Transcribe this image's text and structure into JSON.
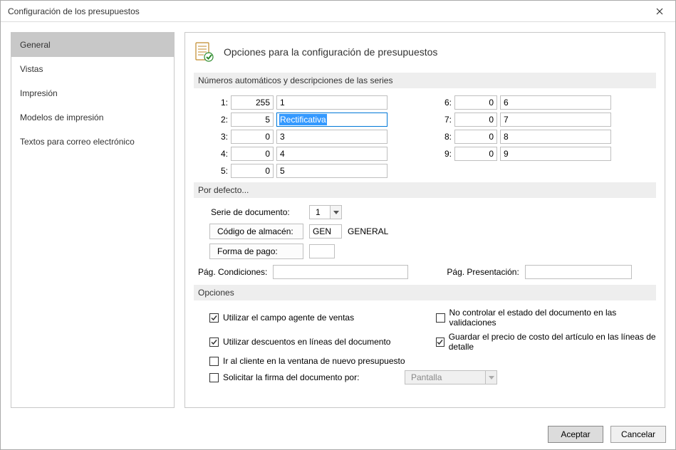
{
  "window": {
    "title": "Configuración de los presupuestos"
  },
  "sidebar": {
    "items": [
      {
        "label": "General",
        "selected": true
      },
      {
        "label": "Vistas"
      },
      {
        "label": "Impresión"
      },
      {
        "label": "Modelos de impresión"
      },
      {
        "label": "Textos para correo electrónico"
      }
    ]
  },
  "header": {
    "title": "Opciones para la configuración de presupuestos"
  },
  "sections": {
    "series": {
      "heading": "Números automáticos y descripciones de las series",
      "rows": [
        {
          "idx": "1:",
          "num": "255",
          "desc": "1"
        },
        {
          "idx": "2:",
          "num": "5",
          "desc": "Rectificativa",
          "focused": true
        },
        {
          "idx": "3:",
          "num": "0",
          "desc": "3"
        },
        {
          "idx": "4:",
          "num": "0",
          "desc": "4"
        },
        {
          "idx": "5:",
          "num": "0",
          "desc": "5"
        },
        {
          "idx": "6:",
          "num": "0",
          "desc": "6"
        },
        {
          "idx": "7:",
          "num": "0",
          "desc": "7"
        },
        {
          "idx": "8:",
          "num": "0",
          "desc": "8"
        },
        {
          "idx": "9:",
          "num": "0",
          "desc": "9"
        }
      ]
    },
    "defaults": {
      "heading": "Por defecto...",
      "serie_label": "Serie de documento:",
      "serie_value": "1",
      "almacen_btn": "Código de almacén:",
      "almacen_code": "GEN",
      "almacen_name": "GENERAL",
      "pago_btn": "Forma de pago:",
      "pago_value": "",
      "cond_label": "Pág. Condiciones:",
      "cond_value": "",
      "pres_label": "Pág. Presentación:",
      "pres_value": ""
    },
    "options": {
      "heading": "Opciones",
      "opt_agent": "Utilizar el campo agente de ventas",
      "opt_no_control": "No controlar el estado del documento en las validaciones",
      "opt_discounts": "Utilizar descuentos en líneas del documento",
      "opt_save_cost": "Guardar el precio de costo del artículo en las líneas de detalle",
      "opt_goto_client": "Ir al cliente en la ventana de nuevo presupuesto",
      "opt_sign": "Solicitar la firma del documento por:",
      "sign_method": "Pantalla",
      "checked": {
        "agent": true,
        "no_control": false,
        "discounts": true,
        "save_cost": true,
        "goto_client": false,
        "sign": false
      }
    }
  },
  "footer": {
    "accept": "Aceptar",
    "cancel": "Cancelar"
  }
}
